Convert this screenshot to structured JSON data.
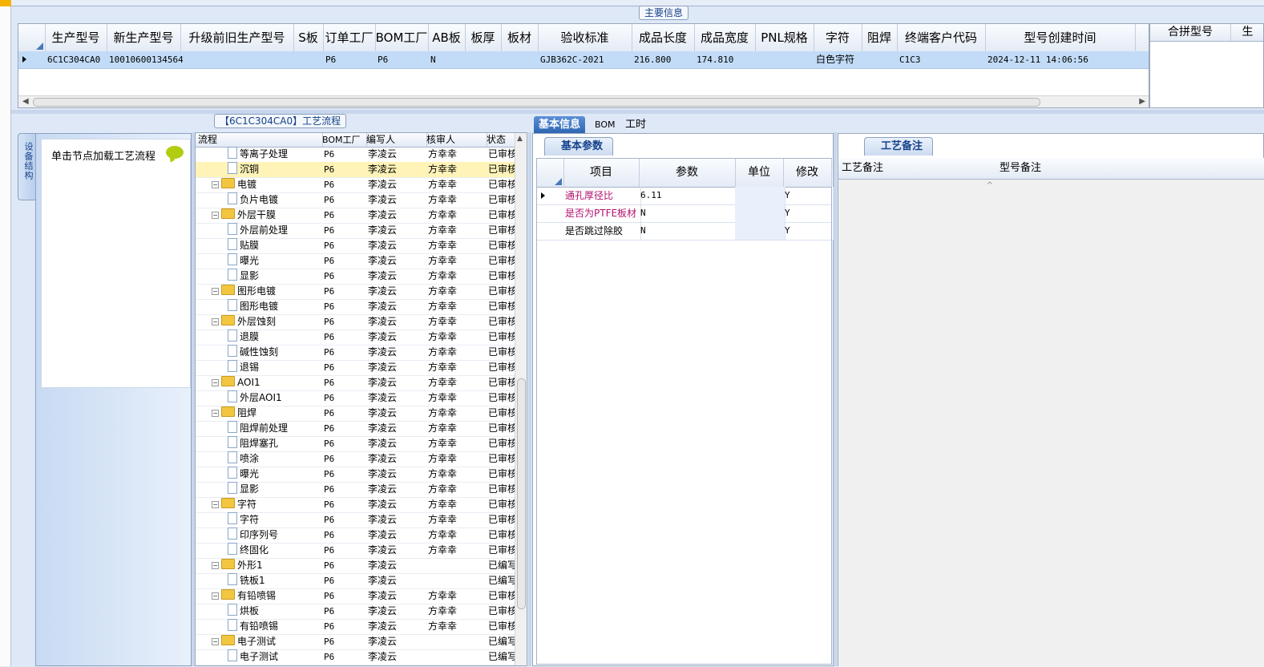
{
  "main_group_title": "主要信息",
  "main_grid": {
    "columns": [
      "生产型号",
      "新生产型号",
      "升级前旧生产型号",
      "S板",
      "订单工厂",
      "BOM工厂",
      "AB板",
      "板厚",
      "板材",
      "验收标准",
      "成品长度",
      "成品宽度",
      "PNL规格",
      "字符",
      "阻焊",
      "终端客户代码",
      "型号创建时间"
    ],
    "row": [
      "6C1C304CA0",
      "10010600134564",
      "",
      "",
      "P6",
      "P6",
      "N",
      "",
      "",
      "GJB362C-2021",
      "216.800",
      "174.810",
      "",
      "白色字符",
      "",
      "C1C3",
      "2024-12-11 14:06:56"
    ]
  },
  "right_grid": {
    "columns": [
      "合拼型号",
      "生"
    ]
  },
  "left_tab_label": "设备结构",
  "nav_hint": "单击节点加载工艺流程",
  "tree_group_title": "【6C1C304CA0】工艺流程",
  "tree": {
    "columns": [
      "流程",
      "BOM工厂",
      "编写人",
      "核审人",
      "状态"
    ],
    "rows": [
      {
        "level": 2,
        "type": "file",
        "name": "等离子处理",
        "bom": "P6",
        "writer": "李凌云",
        "reviewer": "方幸幸",
        "status": "已审核"
      },
      {
        "level": 2,
        "type": "file",
        "name": "沉铜",
        "bom": "P6",
        "writer": "李凌云",
        "reviewer": "方幸幸",
        "status": "已审核",
        "selected": true
      },
      {
        "level": 1,
        "type": "folder",
        "name": "电镀",
        "bom": "P6",
        "writer": "李凌云",
        "reviewer": "方幸幸",
        "status": "已审核"
      },
      {
        "level": 2,
        "type": "file",
        "name": "负片电镀",
        "bom": "P6",
        "writer": "李凌云",
        "reviewer": "方幸幸",
        "status": "已审核"
      },
      {
        "level": 1,
        "type": "folder",
        "name": "外层干膜",
        "bom": "P6",
        "writer": "李凌云",
        "reviewer": "方幸幸",
        "status": "已审核"
      },
      {
        "level": 2,
        "type": "file",
        "name": "外层前处理",
        "bom": "P6",
        "writer": "李凌云",
        "reviewer": "方幸幸",
        "status": "已审核"
      },
      {
        "level": 2,
        "type": "file",
        "name": "贴膜",
        "bom": "P6",
        "writer": "李凌云",
        "reviewer": "方幸幸",
        "status": "已审核"
      },
      {
        "level": 2,
        "type": "file",
        "name": "曝光",
        "bom": "P6",
        "writer": "李凌云",
        "reviewer": "方幸幸",
        "status": "已审核"
      },
      {
        "level": 2,
        "type": "file",
        "name": "显影",
        "bom": "P6",
        "writer": "李凌云",
        "reviewer": "方幸幸",
        "status": "已审核"
      },
      {
        "level": 1,
        "type": "folder",
        "name": "图形电镀",
        "bom": "P6",
        "writer": "李凌云",
        "reviewer": "方幸幸",
        "status": "已审核"
      },
      {
        "level": 2,
        "type": "file",
        "name": "图形电镀",
        "bom": "P6",
        "writer": "李凌云",
        "reviewer": "方幸幸",
        "status": "已审核"
      },
      {
        "level": 1,
        "type": "folder",
        "name": "外层蚀刻",
        "bom": "P6",
        "writer": "李凌云",
        "reviewer": "方幸幸",
        "status": "已审核"
      },
      {
        "level": 2,
        "type": "file",
        "name": "退膜",
        "bom": "P6",
        "writer": "李凌云",
        "reviewer": "方幸幸",
        "status": "已审核"
      },
      {
        "level": 2,
        "type": "file",
        "name": "碱性蚀刻",
        "bom": "P6",
        "writer": "李凌云",
        "reviewer": "方幸幸",
        "status": "已审核"
      },
      {
        "level": 2,
        "type": "file",
        "name": "退锡",
        "bom": "P6",
        "writer": "李凌云",
        "reviewer": "方幸幸",
        "status": "已审核"
      },
      {
        "level": 1,
        "type": "folder",
        "name": "AOI1",
        "bom": "P6",
        "writer": "李凌云",
        "reviewer": "方幸幸",
        "status": "已审核"
      },
      {
        "level": 2,
        "type": "file",
        "name": "外层AOI1",
        "bom": "P6",
        "writer": "李凌云",
        "reviewer": "方幸幸",
        "status": "已审核"
      },
      {
        "level": 1,
        "type": "folder",
        "name": "阻焊",
        "bom": "P6",
        "writer": "李凌云",
        "reviewer": "方幸幸",
        "status": "已审核"
      },
      {
        "level": 2,
        "type": "file",
        "name": "阻焊前处理",
        "bom": "P6",
        "writer": "李凌云",
        "reviewer": "方幸幸",
        "status": "已审核"
      },
      {
        "level": 2,
        "type": "file",
        "name": "阻焊塞孔",
        "bom": "P6",
        "writer": "李凌云",
        "reviewer": "方幸幸",
        "status": "已审核"
      },
      {
        "level": 2,
        "type": "file",
        "name": "喷涂",
        "bom": "P6",
        "writer": "李凌云",
        "reviewer": "方幸幸",
        "status": "已审核"
      },
      {
        "level": 2,
        "type": "file",
        "name": "曝光",
        "bom": "P6",
        "writer": "李凌云",
        "reviewer": "方幸幸",
        "status": "已审核"
      },
      {
        "level": 2,
        "type": "file",
        "name": "显影",
        "bom": "P6",
        "writer": "李凌云",
        "reviewer": "方幸幸",
        "status": "已审核"
      },
      {
        "level": 1,
        "type": "folder",
        "name": "字符",
        "bom": "P6",
        "writer": "李凌云",
        "reviewer": "方幸幸",
        "status": "已审核"
      },
      {
        "level": 2,
        "type": "file",
        "name": "字符",
        "bom": "P6",
        "writer": "李凌云",
        "reviewer": "方幸幸",
        "status": "已审核"
      },
      {
        "level": 2,
        "type": "file",
        "name": "印序列号",
        "bom": "P6",
        "writer": "李凌云",
        "reviewer": "方幸幸",
        "status": "已审核"
      },
      {
        "level": 2,
        "type": "file",
        "name": "终固化",
        "bom": "P6",
        "writer": "李凌云",
        "reviewer": "方幸幸",
        "status": "已审核"
      },
      {
        "level": 1,
        "type": "folder",
        "name": "外形1",
        "bom": "P6",
        "writer": "李凌云",
        "reviewer": "",
        "status": "已编写"
      },
      {
        "level": 2,
        "type": "file",
        "name": "铣板1",
        "bom": "P6",
        "writer": "李凌云",
        "reviewer": "",
        "status": "已编写"
      },
      {
        "level": 1,
        "type": "folder",
        "name": "有铅喷锡",
        "bom": "P6",
        "writer": "李凌云",
        "reviewer": "方幸幸",
        "status": "已审核"
      },
      {
        "level": 2,
        "type": "file",
        "name": "烘板",
        "bom": "P6",
        "writer": "李凌云",
        "reviewer": "方幸幸",
        "status": "已审核"
      },
      {
        "level": 2,
        "type": "file",
        "name": "有铅喷锡",
        "bom": "P6",
        "writer": "李凌云",
        "reviewer": "方幸幸",
        "status": "已审核"
      },
      {
        "level": 1,
        "type": "folder",
        "name": "电子测试",
        "bom": "P6",
        "writer": "李凌云",
        "reviewer": "",
        "status": "已编写"
      },
      {
        "level": 2,
        "type": "file",
        "name": "电子测试",
        "bom": "P6",
        "writer": "李凌云",
        "reviewer": "",
        "status": "已编写"
      }
    ]
  },
  "tabs": [
    "基本信息",
    "BOM",
    "工时"
  ],
  "params": {
    "subtab": "基本参数",
    "columns": [
      "项目",
      "参数",
      "单位",
      "修改"
    ],
    "rows": [
      {
        "item": "通孔厚径比",
        "value": "6.11",
        "unit": "",
        "modify": "Y",
        "color": "#b0126e"
      },
      {
        "item": "是否为PTFE板材",
        "value": "N",
        "unit": "",
        "modify": "Y",
        "color": "#b0126e"
      },
      {
        "item": "是否跳过除胶",
        "value": "N",
        "unit": "",
        "modify": "Y",
        "color": "#000000"
      }
    ]
  },
  "notes": {
    "subtab": "工艺备注",
    "col1": "工艺备注",
    "col2": "型号备注"
  },
  "colors": {
    "selection_row": "#c2dcf7",
    "tree_selected": "#fff3b8",
    "active_tab": "#2f66b3"
  }
}
